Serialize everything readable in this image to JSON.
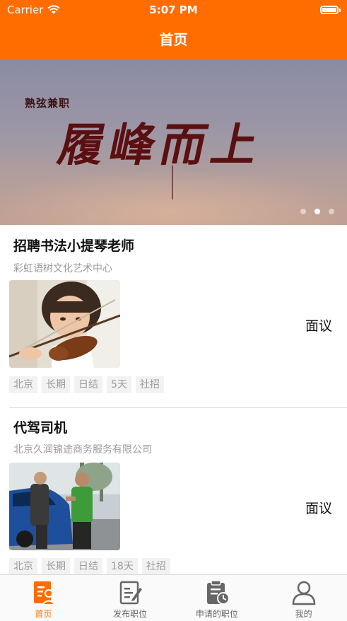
{
  "status_bar": {
    "carrier": "Carrier",
    "time": "5:07 PM"
  },
  "nav": {
    "title": "首页"
  },
  "banner": {
    "small_title": "熟弦兼职",
    "big_title": "履峰而上",
    "dot_count": 3,
    "active_dot": 1
  },
  "jobs": [
    {
      "title": "招聘书法小提琴老师",
      "company": "彩虹语树文化艺术中心",
      "salary": "面议",
      "tags": [
        "北京",
        "长期",
        "日结",
        "5天",
        "社招"
      ]
    },
    {
      "title": "代驾司机",
      "company": "北京久润锦途商务服务有限公司",
      "salary": "面议",
      "tags": [
        "北京",
        "长期",
        "日结",
        "18天",
        "社招"
      ]
    }
  ],
  "tab_bar": {
    "items": [
      {
        "label": "首页",
        "icon": "home-document-icon",
        "active": true
      },
      {
        "label": "发布职位",
        "icon": "edit-document-icon",
        "active": false
      },
      {
        "label": "申请的职位",
        "icon": "clipboard-clock-icon",
        "active": false
      },
      {
        "label": "我的",
        "icon": "user-profile-icon",
        "active": false
      }
    ]
  },
  "colors": {
    "brand": "#ff6d00",
    "tag_bg": "#f2f2f2",
    "muted_text": "#9a9a9a"
  }
}
